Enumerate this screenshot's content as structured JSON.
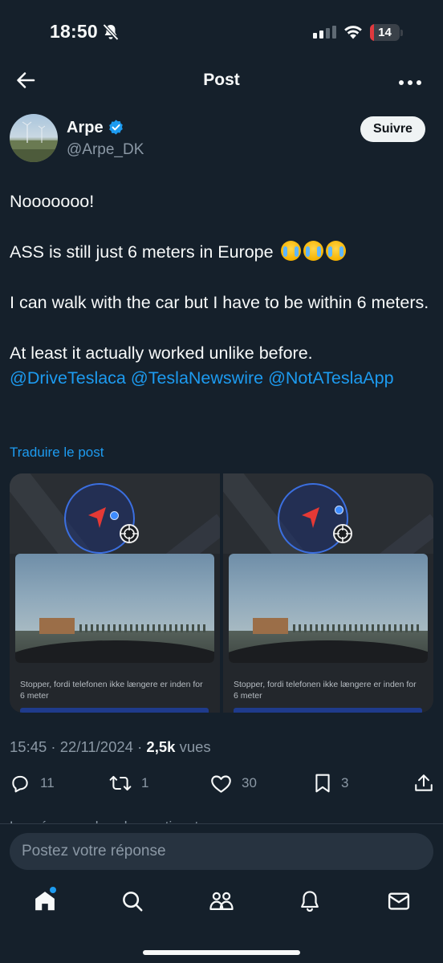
{
  "status_bar": {
    "time": "18:50",
    "battery_level": "14",
    "battery_fraction": 0.14,
    "icons": [
      "bell-off-icon",
      "signal-icon",
      "wifi-icon",
      "battery-icon"
    ]
  },
  "header": {
    "title": "Post",
    "back_icon": "arrow-left-icon",
    "more_icon": "more-horizontal-icon"
  },
  "author": {
    "name": "Arpe",
    "handle": "@Arpe_DK",
    "verified": true,
    "follow_label": "Suivre"
  },
  "tweet": {
    "line1": "Nooooooo!",
    "line2": "ASS is still just 6 meters in Europe",
    "line2_emojis": [
      "loudly-crying-face",
      "loudly-crying-face",
      "loudly-crying-face"
    ],
    "line3": "I can walk with the car but I have to be within 6 meters.",
    "line4": "At least it actually worked unlike before.",
    "mentions": [
      "@DriveTeslaca",
      "@TeslaNewswire",
      "@NotATeslaApp"
    ]
  },
  "translate_label": "Traduire le post",
  "media": [
    {
      "caption": "Stopper, fordi telefonen ikke længere er inden for 6 meter"
    },
    {
      "caption": "Stopper, fordi telefonen ikke længere er inden for 6 meter"
    }
  ],
  "meta": {
    "time": "15:45",
    "date": "22/11/2024",
    "views": "2,5k",
    "views_label": "vues"
  },
  "actions": {
    "replies": "11",
    "reposts": "1",
    "likes": "30",
    "bookmarks": "3"
  },
  "partial_text": "Les réponses les plus pertinentes",
  "reply": {
    "placeholder": "Postez votre réponse"
  },
  "tabs": [
    "home-icon",
    "search-icon",
    "communities-icon",
    "notifications-icon",
    "messages-icon"
  ],
  "colors": {
    "background": "#15202b",
    "accent": "#1d9bf0",
    "secondary_text": "#8b98a5"
  }
}
